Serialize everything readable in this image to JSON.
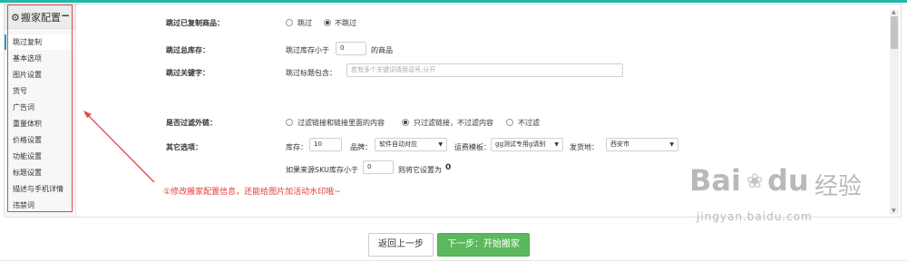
{
  "sidebar": {
    "title": "搬家配置",
    "items": [
      {
        "label": "跳过复制"
      },
      {
        "label": "基本选项"
      },
      {
        "label": "图片设置"
      },
      {
        "label": "货号"
      },
      {
        "label": "广告词"
      },
      {
        "label": "重量体积"
      },
      {
        "label": "价格设置"
      },
      {
        "label": "功能设置"
      },
      {
        "label": "标题设置"
      },
      {
        "label": "描述与手机详情"
      },
      {
        "label": "违禁词"
      }
    ]
  },
  "form": {
    "skip_copied": {
      "label": "跳过已复制商品：",
      "options": [
        "跳过",
        "不跳过"
      ],
      "selected": "不跳过"
    },
    "skip_stock": {
      "label": "跳过总库存：",
      "prefix": "跳过库存小于",
      "value": "0",
      "suffix": "的商品"
    },
    "skip_keyword": {
      "label": "跳过关键字：",
      "prefix": "跳过标题包含：",
      "placeholder": "若有多个关键词请用逗号,分开"
    },
    "filter_links": {
      "label": "是否过滤外链：",
      "options": [
        "过滤链接和链接里面的内容",
        "只过滤链接，不过滤内容",
        "不过滤"
      ],
      "selected": "只过滤链接，不过滤内容"
    },
    "other": {
      "label": "其它选项：",
      "stock_label": "库存：",
      "stock_value": "10",
      "brand_label": "品牌：",
      "brand_value": "软件自动对应",
      "shipping_label": "运费模板：",
      "shipping_value": "gg测试专用g请别",
      "origin_label": "发货地：",
      "origin_value": "西安市",
      "sku_prefix": "如果来源SKU库存小于",
      "sku_value": "0",
      "sku_suffix": "则将它设置为",
      "sku_set_value": "0"
    }
  },
  "annotation": {
    "note": "①修改搬家配置信息，还能给图片加活动水印哦~"
  },
  "buttons": {
    "back": "返回上一步",
    "next": "下一步：开始搬家"
  },
  "watermark": {
    "brand": "Bai",
    "brand2": "du",
    "brand_cn": "经验",
    "url": "jingyan.baidu.com"
  },
  "colors": {
    "accent": "#22b8a8",
    "next_button": "#5cb85c",
    "annotation_red": "#e23b3b",
    "active_item_border": "#1a9aca"
  }
}
